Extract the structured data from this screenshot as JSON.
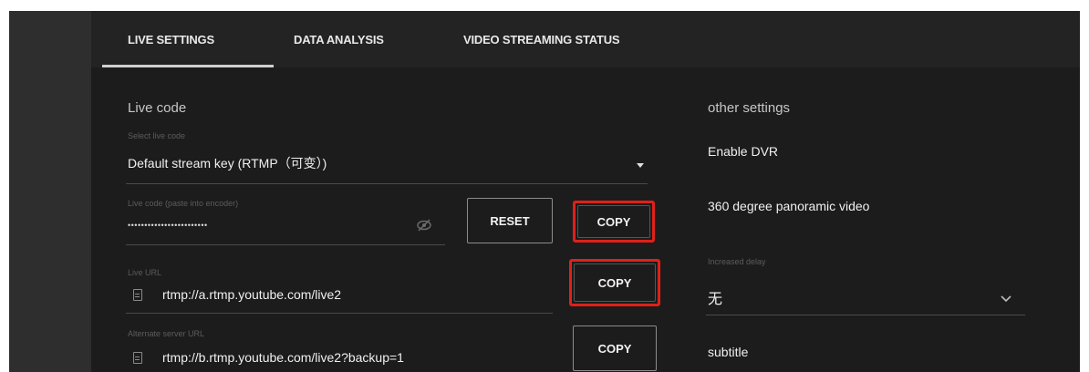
{
  "tabs": [
    {
      "label": "LIVE SETTINGS"
    },
    {
      "label": "DATA ANALYSIS"
    },
    {
      "label": "VIDEO STREAMING STATUS"
    }
  ],
  "live_code": {
    "title": "Live code",
    "select_label": "Select live code",
    "select_value": "Default stream key (RTMP（可变）)",
    "key_label": "Live code (paste into encoder)",
    "key_value": "••••••••••••••••••••••••",
    "reset_label": "RESET",
    "copy_key_label": "COPY",
    "url_label": "Live URL",
    "url_value": "rtmp://a.rtmp.youtube.com/live2",
    "copy_url_label": "COPY",
    "alt_url_label": "Alternate server URL",
    "alt_url_value": "rtmp://b.rtmp.youtube.com/live2?backup=1",
    "copy_alt_label": "COPY"
  },
  "other_settings": {
    "title": "other settings",
    "dvr_label": "Enable DVR",
    "panoramic_label": "360 degree panoramic video",
    "delay_label": "Increased delay",
    "delay_value": "无",
    "subtitle_label": "subtitle"
  },
  "icons": {
    "visibility": "eye-off-icon",
    "dropdown": "caret-down-icon",
    "chevron": "chevron-down-icon",
    "document": "document-icon"
  },
  "colors": {
    "highlight": "#e0201a",
    "background": "#1c1c1c",
    "tabs_bar": "#232323"
  }
}
